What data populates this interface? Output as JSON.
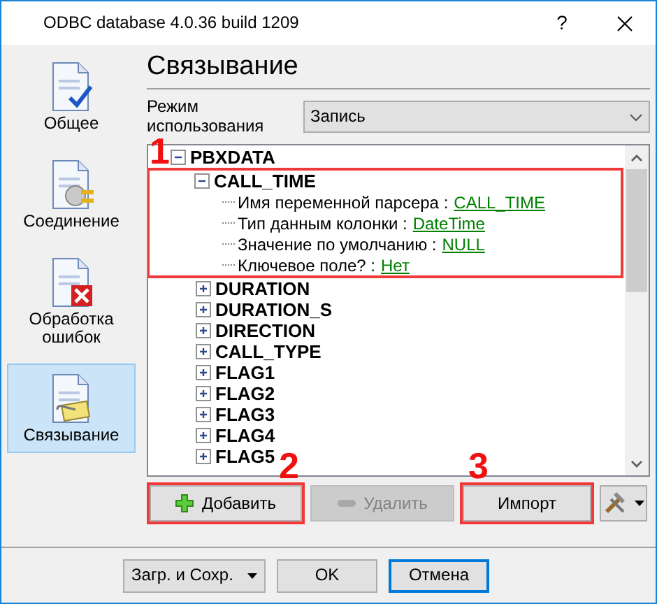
{
  "window": {
    "title": "ODBC database 4.0.36 build 1209",
    "help": "?"
  },
  "sidebar": {
    "items": [
      {
        "label": "Общее",
        "kind": "general",
        "selected": false
      },
      {
        "label": "Соединение",
        "kind": "connection",
        "selected": false
      },
      {
        "label": "Обработка ошибок",
        "kind": "errors",
        "selected": false
      },
      {
        "label": "Связывание",
        "kind": "binding",
        "selected": true
      }
    ]
  },
  "heading": "Связывание",
  "mode": {
    "label": "Режим использования",
    "value": "Запись"
  },
  "tree": [
    {
      "label": "PBXDATA",
      "expanded": true,
      "children": [
        {
          "label": "CALL_TIME",
          "expanded": true,
          "callout": "1",
          "children": [
            {
              "label": "Имя переменной парсера :",
              "value": "CALL_TIME"
            },
            {
              "label": "Тип данным колонки :",
              "value": "DateTime"
            },
            {
              "label": "Значение по умолчанию :",
              "value": "NULL"
            },
            {
              "label": "Ключевое поле? :",
              "value": "Нет"
            }
          ]
        },
        {
          "label": "DURATION",
          "expanded": false
        },
        {
          "label": "DURATION_S",
          "expanded": false
        },
        {
          "label": "DIRECTION",
          "expanded": false
        },
        {
          "label": "CALL_TYPE",
          "expanded": false
        },
        {
          "label": "FLAG1",
          "expanded": false
        },
        {
          "label": "FLAG2",
          "expanded": false
        },
        {
          "label": "FLAG3",
          "expanded": false
        },
        {
          "label": "FLAG4",
          "expanded": false
        },
        {
          "label": "FLAG5",
          "expanded": false
        }
      ]
    }
  ],
  "buttons": [
    {
      "kind": "add",
      "label": "Добавить",
      "disabled": false,
      "callout": "2"
    },
    {
      "kind": "remove",
      "label": "Удалить",
      "disabled": true
    },
    {
      "kind": "plain",
      "label": "Импорт",
      "disabled": false,
      "callout": "3"
    },
    {
      "kind": "tools",
      "disabled": false
    }
  ],
  "footer": [
    {
      "label": "Загр. и Сохр.",
      "dropdown": true,
      "focused": false
    },
    {
      "label": "OK",
      "dropdown": false,
      "focused": false
    },
    {
      "label": "Отмена",
      "dropdown": false,
      "focused": true
    }
  ]
}
